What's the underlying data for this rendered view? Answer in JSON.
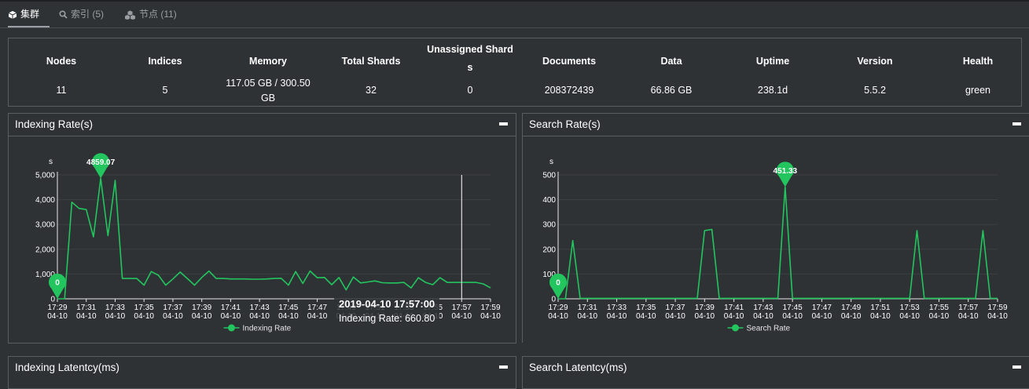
{
  "tabs": [
    {
      "label": "集群",
      "icon": "cube-icon",
      "active": true
    },
    {
      "label": "索引 (5)",
      "icon": "search-icon",
      "active": false
    },
    {
      "label": "节点 (11)",
      "icon": "cubes-icon",
      "active": false
    }
  ],
  "summary": {
    "nodes": {
      "label": "Nodes",
      "value": "11"
    },
    "indices": {
      "label": "Indices",
      "value": "5"
    },
    "memory": {
      "label": "Memory",
      "value": "117.05 GB / 300.50 GB",
      "value_l1": "117.05 GB / 300.50",
      "value_l2": "GB"
    },
    "total_shards": {
      "label": "Total Shards",
      "value": "32"
    },
    "unassigned": {
      "label": "Unassigned Shards",
      "label_l1": "Unassigned Shard",
      "label_l2": "s",
      "value": "0"
    },
    "documents": {
      "label": "Documents",
      "value": "208372439"
    },
    "data": {
      "label": "Data",
      "value": "66.86 GB"
    },
    "uptime": {
      "label": "Uptime",
      "value": "238.1d"
    },
    "version": {
      "label": "Version",
      "value": "5.5.2"
    },
    "health": {
      "label": "Health",
      "value": "green"
    }
  },
  "panels": {
    "indexing_rate": {
      "title": "Indexing Rate(s)"
    },
    "search_rate": {
      "title": "Search Rate(s)"
    },
    "indexing_latency": {
      "title": "Indexing Latentcy(ms)"
    },
    "search_latency": {
      "title": "Search Latentcy(ms)"
    }
  },
  "tooltip": {
    "title": "2019-04-10 17:57:00",
    "body": "Indexing Rate: 660.80"
  },
  "colors": {
    "series": "#22c55e",
    "background": "#2f3235",
    "border": "#5a5e63"
  },
  "chart_data": [
    {
      "type": "line",
      "title": "Indexing Rate(s)",
      "ylabel": "s",
      "ylim": [
        0,
        5000
      ],
      "yticks": [
        "0",
        "1,000",
        "2,000",
        "3,000",
        "4,000",
        "5,000"
      ],
      "ytick_values": [
        0,
        1000,
        2000,
        3000,
        4000,
        5000
      ],
      "x_ticks": [
        [
          "17:29",
          "04-10"
        ],
        [
          "17:31",
          "04-10"
        ],
        [
          "17:33",
          "04-10"
        ],
        [
          "17:35",
          "04-10"
        ],
        [
          "17:37",
          "04-10"
        ],
        [
          "17:39",
          "04-10"
        ],
        [
          "17:41",
          "04-10"
        ],
        [
          "17:43",
          "04-10"
        ],
        [
          "17:45",
          "04-10"
        ],
        [
          "17:47",
          "04-10"
        ],
        [
          "17:49",
          "04-10"
        ],
        [
          "17:51",
          "04-10"
        ],
        [
          "17:53",
          "04-10"
        ],
        [
          "17:55",
          "04-10"
        ],
        [
          "17:57",
          "04-10"
        ],
        [
          "17:59",
          "04-10"
        ]
      ],
      "x_tick_minutes": [
        0,
        2,
        4,
        6,
        8,
        10,
        12,
        14,
        16,
        18,
        20,
        22,
        24,
        26,
        28,
        30
      ],
      "legend": "Indexing Rate",
      "series": [
        {
          "name": "Indexing Rate",
          "x_minutes": [
            0,
            0.5,
            1,
            1.5,
            2,
            2.5,
            3,
            3.5,
            4,
            4.5,
            5,
            5.5,
            6,
            6.5,
            7,
            7.5,
            8,
            8.5,
            9,
            9.5,
            10,
            10.5,
            11,
            11.5,
            12,
            12.5,
            13,
            13.5,
            14,
            14.5,
            15,
            15.5,
            16,
            16.5,
            17,
            17.5,
            18,
            18.5,
            19,
            19.5,
            20,
            20.5,
            21,
            21.5,
            22,
            22.5,
            23,
            23.5,
            24,
            24.5,
            25,
            25.5,
            26,
            26.5,
            27,
            27.5,
            28,
            28.5,
            29,
            29.5,
            30
          ],
          "values": [
            0,
            0,
            3900,
            3650,
            3600,
            2500,
            4860,
            2550,
            4780,
            820,
            820,
            820,
            550,
            1100,
            950,
            550,
            800,
            1080,
            820,
            550,
            860,
            1120,
            820,
            820,
            800,
            800,
            800,
            790,
            790,
            800,
            820,
            830,
            550,
            1100,
            620,
            1120,
            850,
            860,
            570,
            860,
            360,
            880,
            640,
            680,
            720,
            650,
            640,
            640,
            660,
            440,
            850,
            660,
            570,
            850,
            661,
            661,
            661,
            661,
            661,
            600,
            440
          ]
        }
      ],
      "markers": [
        {
          "label": "4859.07",
          "value": 4859.07,
          "x_minutes": 3
        },
        {
          "label": "0",
          "value": 0,
          "x_minutes": 0
        }
      ]
    },
    {
      "type": "line",
      "title": "Search Rate(s)",
      "ylabel": "s",
      "ylim": [
        0,
        500
      ],
      "yticks": [
        "0",
        "100",
        "200",
        "300",
        "400",
        "500"
      ],
      "ytick_values": [
        0,
        100,
        200,
        300,
        400,
        500
      ],
      "x_ticks": [
        [
          "17:29",
          "04-10"
        ],
        [
          "17:31",
          "04-10"
        ],
        [
          "17:33",
          "04-10"
        ],
        [
          "17:35",
          "04-10"
        ],
        [
          "17:37",
          "04-10"
        ],
        [
          "17:39",
          "04-10"
        ],
        [
          "17:41",
          "04-10"
        ],
        [
          "17:43",
          "04-10"
        ],
        [
          "17:45",
          "04-10"
        ],
        [
          "17:47",
          "04-10"
        ],
        [
          "17:49",
          "04-10"
        ],
        [
          "17:51",
          "04-10"
        ],
        [
          "17:53",
          "04-10"
        ],
        [
          "17:55",
          "04-10"
        ],
        [
          "17:57",
          "04-10"
        ],
        [
          "17:59",
          "04-10"
        ]
      ],
      "x_tick_minutes": [
        0,
        2,
        4,
        6,
        8,
        10,
        12,
        14,
        16,
        18,
        20,
        22,
        24,
        26,
        28,
        30
      ],
      "legend": "Search Rate",
      "series": [
        {
          "name": "Search Rate",
          "x_minutes": [
            0,
            0.5,
            1,
            1.5,
            2,
            2.5,
            3,
            3.5,
            4,
            4.5,
            5,
            5.5,
            6,
            6.5,
            7,
            7.5,
            8,
            8.5,
            9,
            9.5,
            10,
            10.5,
            11,
            11.5,
            12,
            12.5,
            13,
            13.5,
            14,
            14.5,
            15,
            15.5,
            16,
            16.5,
            17,
            17.5,
            18,
            18.5,
            19,
            19.5,
            20,
            20.5,
            21,
            21.5,
            22,
            22.5,
            23,
            23.5,
            24,
            24.5,
            25,
            25.5,
            26,
            26.5,
            27,
            27.5,
            28,
            28.5,
            29,
            29.5,
            30
          ],
          "values": [
            0,
            0,
            235,
            2,
            2,
            2,
            2,
            2,
            2,
            2,
            2,
            2,
            2,
            2,
            2,
            2,
            2,
            2,
            2,
            2,
            275,
            280,
            2,
            2,
            2,
            2,
            2,
            2,
            2,
            2,
            2,
            451.33,
            2,
            2,
            2,
            2,
            2,
            2,
            2,
            2,
            2,
            2,
            2,
            2,
            2,
            2,
            2,
            2,
            2,
            275,
            2,
            2,
            2,
            2,
            2,
            2,
            2,
            2,
            275,
            2,
            2
          ]
        }
      ],
      "markers": [
        {
          "label": "451.33",
          "value": 451.33,
          "x_minutes": 15.5
        },
        {
          "label": "0",
          "value": 0,
          "x_minutes": 0
        }
      ]
    }
  ]
}
